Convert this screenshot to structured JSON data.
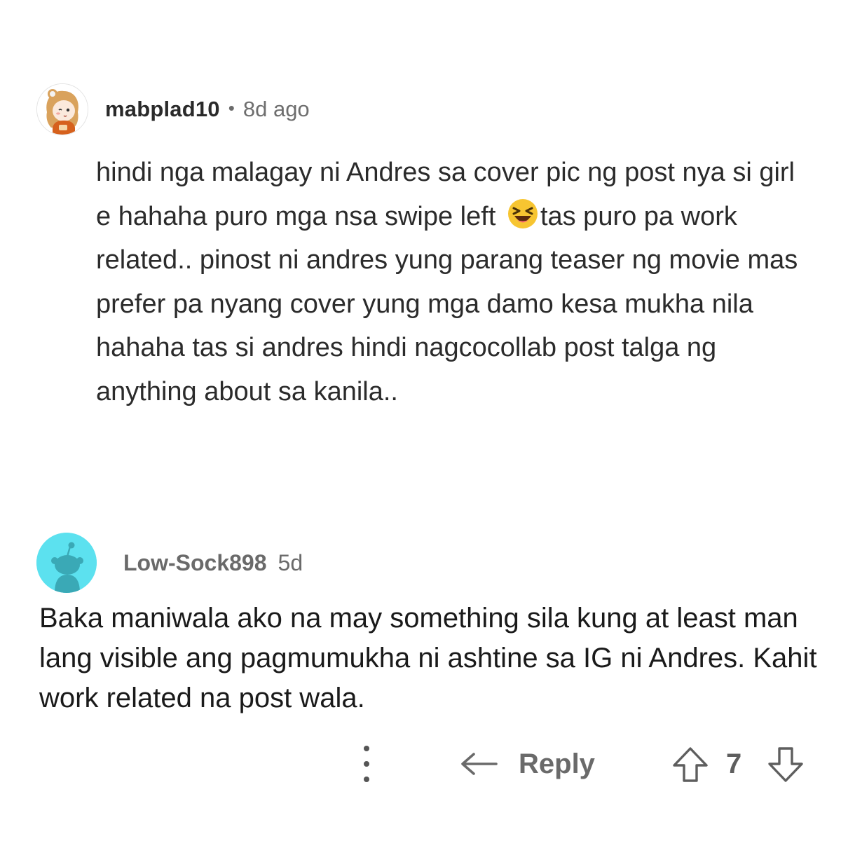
{
  "comments": [
    {
      "username": "mabplad10",
      "separator": "•",
      "timestamp": "8d ago",
      "text_before_emoji": "hindi nga malagay ni Andres sa cover pic ng post nya si girl e hahaha puro mga nsa swipe left",
      "emoji": "laughing-squinting-face",
      "text_after_emoji": "tas puro pa work related.. pinost ni andres yung parang teaser ng movie mas prefer pa nyang cover yung mga damo kesa mukha nila hahaha tas si andres hindi nagcocollab post talga ng anything about sa kanila.."
    },
    {
      "username": "Low-Sock898",
      "timestamp": "5d",
      "text": "Baka maniwala ako na may something sila kung at least man lang visible ang pagmumukha ni ashtine sa IG ni Andres. Kahit work related na post wala."
    }
  ],
  "actions": {
    "more_icon": "more-vertical-icon",
    "reply_icon": "reply-arrow-icon",
    "reply_label": "Reply",
    "upvote_icon": "upvote-arrow-icon",
    "vote_count": "7",
    "downvote_icon": "downvote-arrow-icon"
  },
  "colors": {
    "avatar_2_background": "#5ce1ef",
    "muted_text": "#6a6a6a"
  }
}
